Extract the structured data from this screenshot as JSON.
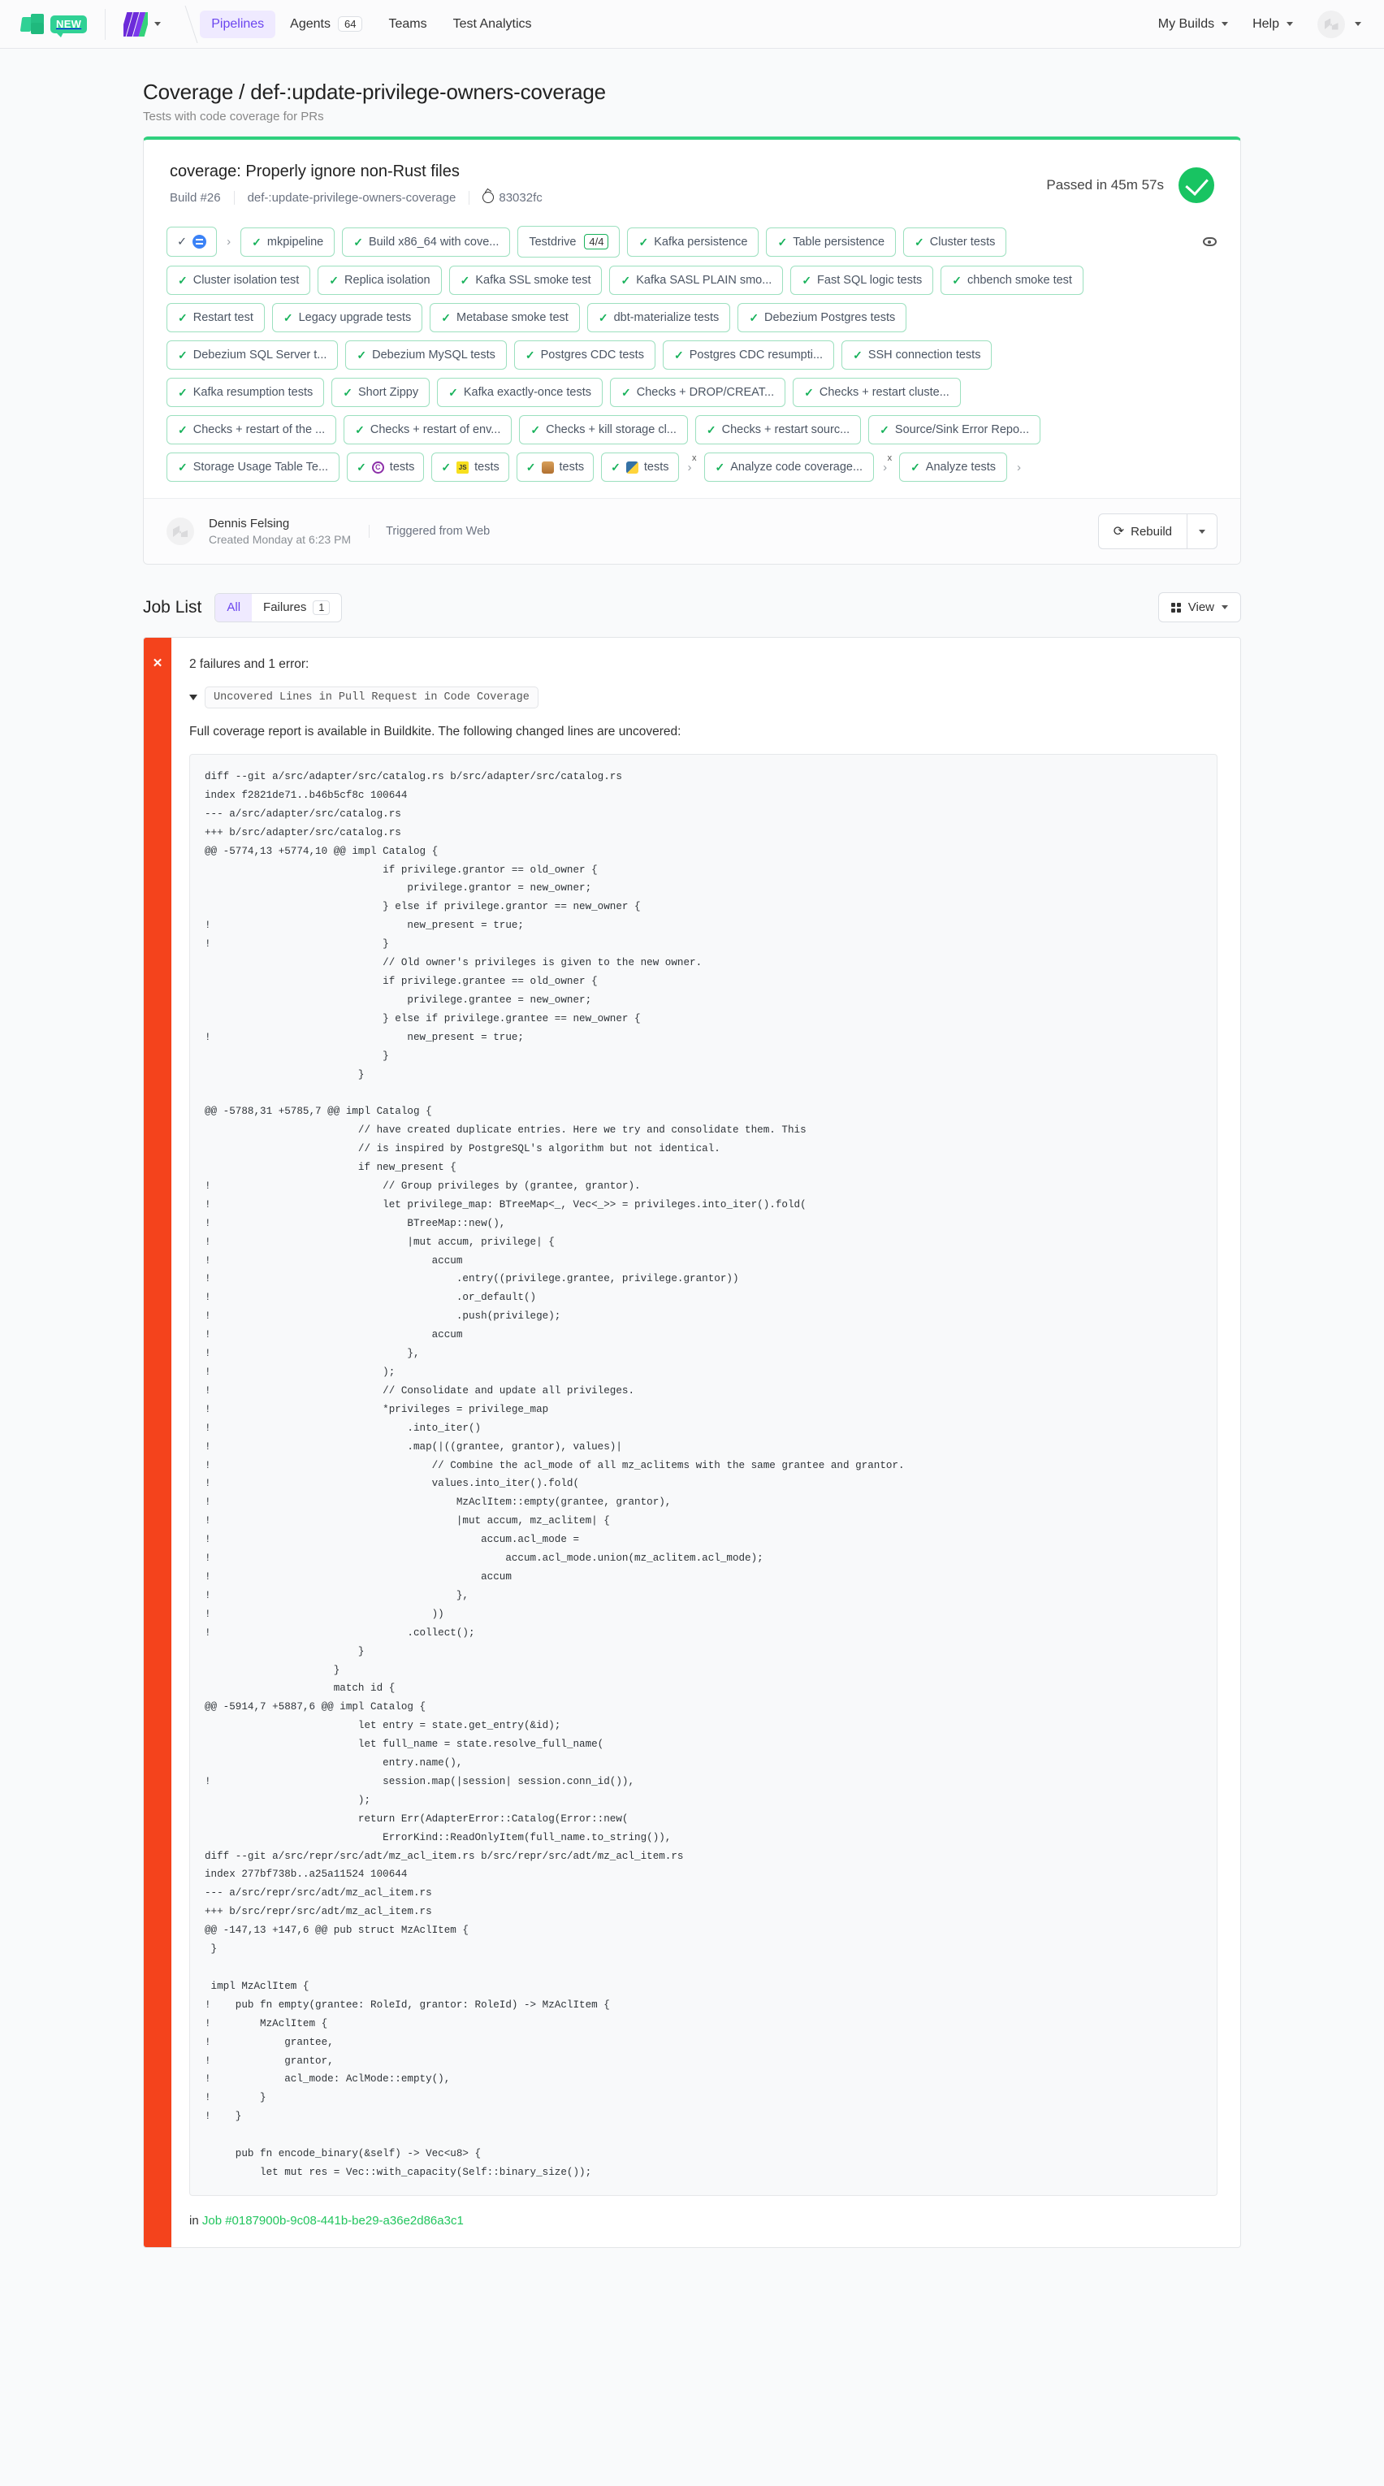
{
  "nav": {
    "new_badge": "NEW",
    "items": [
      {
        "label": "Pipelines",
        "count": null,
        "active": true
      },
      {
        "label": "Agents",
        "count": "64",
        "active": false
      },
      {
        "label": "Teams",
        "count": null,
        "active": false
      },
      {
        "label": "Test Analytics",
        "count": null,
        "active": false
      }
    ],
    "right": [
      {
        "label": "My Builds"
      },
      {
        "label": "Help"
      }
    ]
  },
  "page": {
    "title": "Coverage / def-:update-privilege-owners-coverage",
    "subtitle": "Tests with code coverage for PRs"
  },
  "build": {
    "message": "coverage: Properly ignore non-Rust files",
    "number": "Build #26",
    "branch": "def-:update-privilege-owners-coverage",
    "commit": "83032fc",
    "status_text": "Passed in 45m 57s",
    "status_color": "#18c462",
    "author": "Dennis Felsing",
    "created": "Created Monday at 6:23 PM",
    "trigger": "Triggered from Web",
    "rebuild_label": "Rebuild"
  },
  "pill_rows": [
    [
      {
        "type": "group",
        "parts": [
          {
            "tick": true,
            "label": ""
          },
          {
            "icon": "pipeline-upload-icon"
          }
        ]
      },
      {
        "type": "chev"
      },
      {
        "type": "pill",
        "tick": true,
        "label": "mkpipeline"
      },
      {
        "type": "pill",
        "tick": true,
        "label": "Build x86_64 with cove..."
      },
      {
        "type": "pill",
        "tick": false,
        "label": "Testdrive",
        "badge": "4/4"
      },
      {
        "type": "pill",
        "tick": true,
        "label": "Kafka persistence"
      },
      {
        "type": "pill",
        "tick": true,
        "label": "Table persistence"
      },
      {
        "type": "pill",
        "tick": true,
        "label": "Cluster tests"
      },
      {
        "type": "eye"
      }
    ],
    [
      {
        "type": "pill",
        "tick": true,
        "label": "Cluster isolation test"
      },
      {
        "type": "pill",
        "tick": true,
        "label": "Replica isolation"
      },
      {
        "type": "pill",
        "tick": true,
        "label": "Kafka SSL smoke test"
      },
      {
        "type": "pill",
        "tick": true,
        "label": "Kafka SASL PLAIN smo..."
      },
      {
        "type": "pill",
        "tick": true,
        "label": "Fast SQL logic tests"
      },
      {
        "type": "pill",
        "tick": true,
        "label": "chbench smoke test"
      }
    ],
    [
      {
        "type": "pill",
        "tick": true,
        "label": "Restart test"
      },
      {
        "type": "pill",
        "tick": true,
        "label": "Legacy upgrade tests"
      },
      {
        "type": "pill",
        "tick": true,
        "label": "Metabase smoke test"
      },
      {
        "type": "pill",
        "tick": true,
        "label": "dbt-materialize tests"
      },
      {
        "type": "pill",
        "tick": true,
        "label": "Debezium Postgres tests"
      }
    ],
    [
      {
        "type": "pill",
        "tick": true,
        "label": "Debezium SQL Server t..."
      },
      {
        "type": "pill",
        "tick": true,
        "label": "Debezium MySQL tests"
      },
      {
        "type": "pill",
        "tick": true,
        "label": "Postgres CDC tests"
      },
      {
        "type": "pill",
        "tick": true,
        "label": "Postgres CDC resumpti..."
      },
      {
        "type": "pill",
        "tick": true,
        "label": "SSH connection tests"
      }
    ],
    [
      {
        "type": "pill",
        "tick": true,
        "label": "Kafka resumption tests"
      },
      {
        "type": "pill",
        "tick": true,
        "label": "Short Zippy"
      },
      {
        "type": "pill",
        "tick": true,
        "label": "Kafka exactly-once tests"
      },
      {
        "type": "pill",
        "tick": true,
        "label": "Checks + DROP/CREAT..."
      },
      {
        "type": "pill",
        "tick": true,
        "label": "Checks + restart cluste..."
      }
    ],
    [
      {
        "type": "pill",
        "tick": true,
        "label": "Checks + restart of the ..."
      },
      {
        "type": "pill",
        "tick": true,
        "label": "Checks + restart of env..."
      },
      {
        "type": "pill",
        "tick": true,
        "label": "Checks + kill storage cl..."
      },
      {
        "type": "pill",
        "tick": true,
        "label": "Checks + restart sourc..."
      },
      {
        "type": "pill",
        "tick": true,
        "label": "Source/Sink Error Repo..."
      }
    ],
    [
      {
        "type": "pill",
        "tick": true,
        "label": "Storage Usage Table Te..."
      },
      {
        "type": "pill",
        "tick": true,
        "label": "tests",
        "lang": "c"
      },
      {
        "type": "pill",
        "tick": true,
        "label": "tests",
        "lang": "js"
      },
      {
        "type": "pill",
        "tick": true,
        "label": "tests",
        "lang": "java"
      },
      {
        "type": "pill",
        "tick": true,
        "label": "tests",
        "lang": "py"
      },
      {
        "type": "chevx"
      },
      {
        "type": "pill",
        "tick": true,
        "label": "Analyze code coverage..."
      },
      {
        "type": "chevx"
      },
      {
        "type": "pill",
        "tick": true,
        "label": "Analyze tests"
      },
      {
        "type": "chev"
      }
    ]
  ],
  "joblist": {
    "title": "Job List",
    "tab_all": "All",
    "tab_failures": "Failures",
    "failures_count": "1",
    "view_label": "View"
  },
  "failure": {
    "summary": "2 failures and 1 error:",
    "chip": "Uncovered Lines in Pull Request in Code Coverage",
    "description": "Full coverage report is available in Buildkite. The following changed lines are uncovered:",
    "job_prefix": "in",
    "job_link": "Job #0187900b-9c08-441b-be29-a36e2d86a3c1",
    "diff": "diff --git a/src/adapter/src/catalog.rs b/src/adapter/src/catalog.rs\nindex f2821de71..b46b5cf8c 100644\n--- a/src/adapter/src/catalog.rs\n+++ b/src/adapter/src/catalog.rs\n@@ -5774,13 +5774,10 @@ impl Catalog {\n                             if privilege.grantor == old_owner {\n                                 privilege.grantor = new_owner;\n                             } else if privilege.grantor == new_owner {\n!                                new_present = true;\n!                            }\n                             // Old owner's privileges is given to the new owner.\n                             if privilege.grantee == old_owner {\n                                 privilege.grantee = new_owner;\n                             } else if privilege.grantee == new_owner {\n!                                new_present = true;\n                             }\n                         }\n\n@@ -5788,31 +5785,7 @@ impl Catalog {\n                         // have created duplicate entries. Here we try and consolidate them. This\n                         // is inspired by PostgreSQL's algorithm but not identical.\n                         if new_present {\n!                            // Group privileges by (grantee, grantor).\n!                            let privilege_map: BTreeMap<_, Vec<_>> = privileges.into_iter().fold(\n!                                BTreeMap::new(),\n!                                |mut accum, privilege| {\n!                                    accum\n!                                        .entry((privilege.grantee, privilege.grantor))\n!                                        .or_default()\n!                                        .push(privilege);\n!                                    accum\n!                                },\n!                            );\n!                            // Consolidate and update all privileges.\n!                            *privileges = privilege_map\n!                                .into_iter()\n!                                .map(|((grantee, grantor), values)|\n!                                    // Combine the acl_mode of all mz_aclitems with the same grantee and grantor.\n!                                    values.into_iter().fold(\n!                                        MzAclItem::empty(grantee, grantor),\n!                                        |mut accum, mz_aclitem| {\n!                                            accum.acl_mode =\n!                                                accum.acl_mode.union(mz_aclitem.acl_mode);\n!                                            accum\n!                                        },\n!                                    ))\n!                                .collect();\n                         }\n                     }\n                     match id {\n@@ -5914,7 +5887,6 @@ impl Catalog {\n                         let entry = state.get_entry(&id);\n                         let full_name = state.resolve_full_name(\n                             entry.name(),\n!                            session.map(|session| session.conn_id()),\n                         );\n                         return Err(AdapterError::Catalog(Error::new(\n                             ErrorKind::ReadOnlyItem(full_name.to_string()),\ndiff --git a/src/repr/src/adt/mz_acl_item.rs b/src/repr/src/adt/mz_acl_item.rs\nindex 277bf738b..a25a11524 100644\n--- a/src/repr/src/adt/mz_acl_item.rs\n+++ b/src/repr/src/adt/mz_acl_item.rs\n@@ -147,13 +147,6 @@ pub struct MzAclItem {\n }\n\n impl MzAclItem {\n!    pub fn empty(grantee: RoleId, grantor: RoleId) -> MzAclItem {\n!        MzAclItem {\n!            grantee,\n!            grantor,\n!            acl_mode: AclMode::empty(),\n!        }\n!    }\n\n     pub fn encode_binary(&self) -> Vec<u8> {\n         let mut res = Vec::with_capacity(Self::binary_size());"
  }
}
